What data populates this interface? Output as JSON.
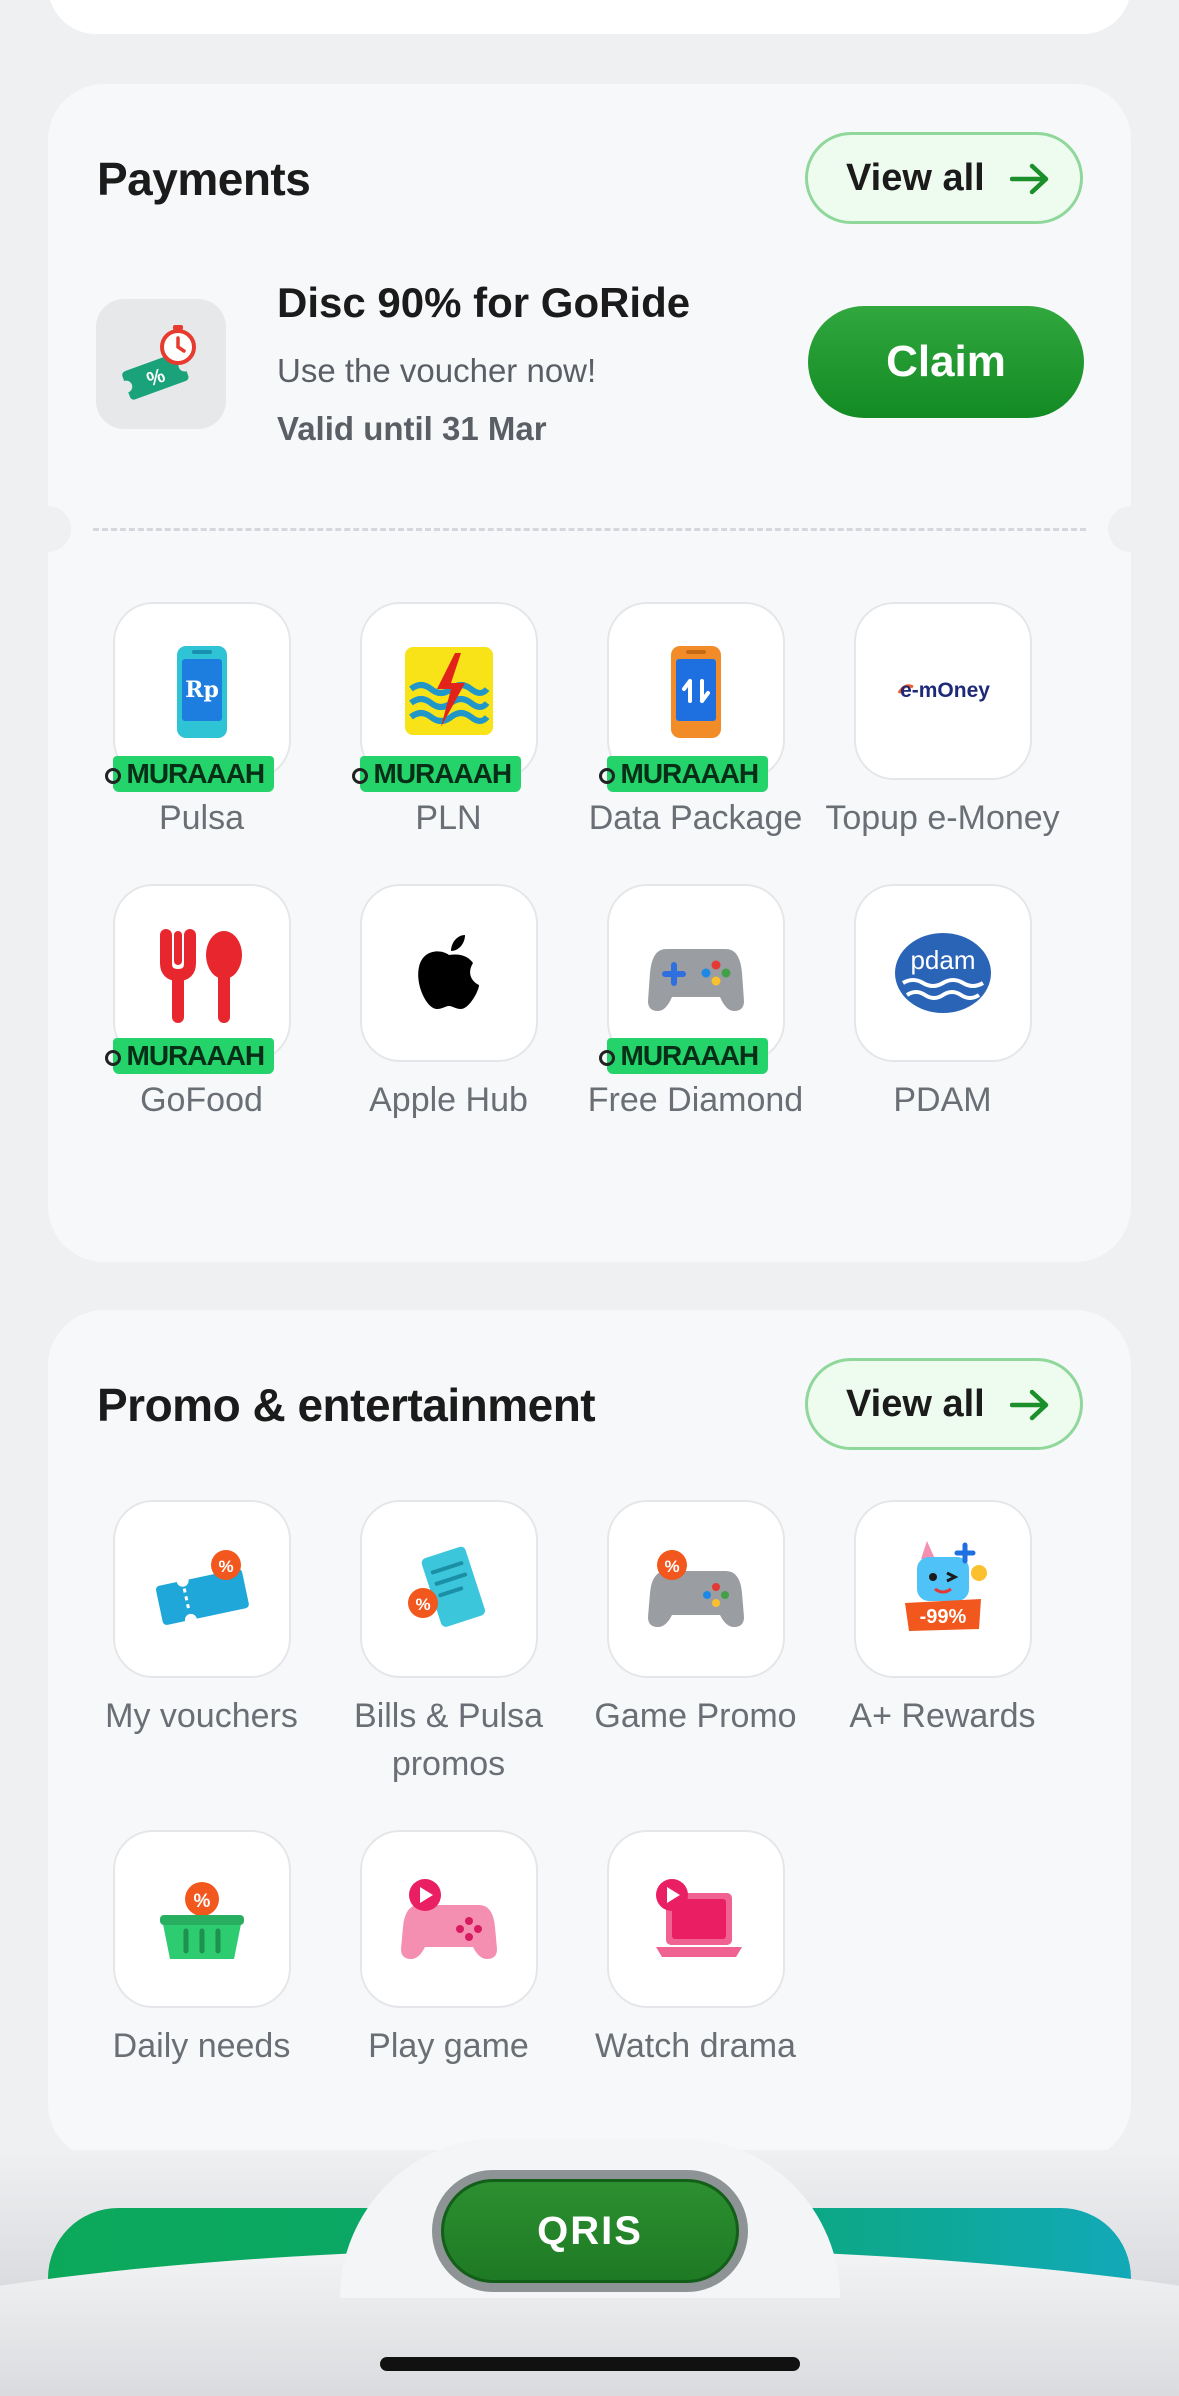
{
  "payments": {
    "title": "Payments",
    "view_all": "View all",
    "voucher": {
      "title": "Disc 90% for GoRide",
      "subtitle": "Use the voucher now!",
      "valid": "Valid until 31 Mar",
      "claim": "Claim"
    },
    "items": [
      {
        "label": "Pulsa",
        "badge": "MURAAAH",
        "icon": "phone-rp-icon"
      },
      {
        "label": "PLN",
        "badge": "MURAAAH",
        "icon": "pln-logo-icon"
      },
      {
        "label": "Data Package",
        "badge": "MURAAAH",
        "icon": "phone-data-icon"
      },
      {
        "label": "Topup e-Money",
        "icon": "emoney-logo-icon"
      },
      {
        "label": "GoFood",
        "badge": "MURAAAH",
        "icon": "gofood-icon"
      },
      {
        "label": "Apple Hub",
        "icon": "apple-logo-icon"
      },
      {
        "label": "Free Diamond",
        "badge": "MURAAAH",
        "icon": "gamepad-icon"
      },
      {
        "label": "PDAM",
        "icon": "pdam-logo-icon"
      }
    ]
  },
  "promo": {
    "title": "Promo & entertainment",
    "view_all": "View all",
    "items": [
      {
        "label": "My vouchers",
        "icon": "voucher-ticket-icon"
      },
      {
        "label": "Bills & Pulsa promos",
        "icon": "bill-receipt-icon"
      },
      {
        "label": "Game Promo",
        "icon": "game-promo-icon"
      },
      {
        "label": "A+ Rewards",
        "icon": "rewards-mascot-icon",
        "tag": "-99%"
      },
      {
        "label": "Daily needs",
        "icon": "shopping-basket-icon"
      },
      {
        "label": "Play game",
        "icon": "play-game-icon"
      },
      {
        "label": "Watch drama",
        "icon": "watch-drama-icon"
      }
    ]
  },
  "emoney_text": "e-mOney",
  "pdam_text": "pdam",
  "qris": "QRIS",
  "colors": {
    "accent_green": "#1a8f2a",
    "badge_green": "#24d36a"
  }
}
